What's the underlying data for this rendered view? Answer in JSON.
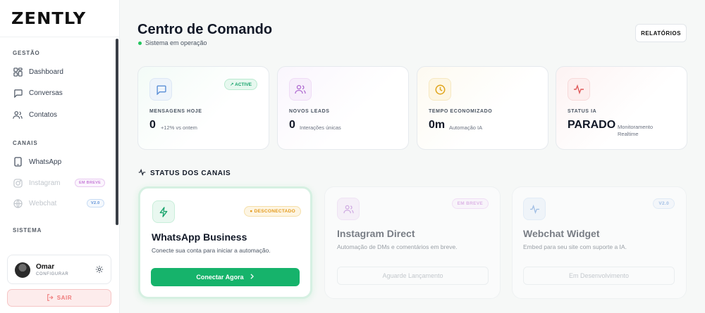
{
  "brand": {
    "logo": "ZENTLY"
  },
  "sidebar": {
    "sections": [
      {
        "title": "GESTÃO"
      },
      {
        "title": "CANAIS"
      },
      {
        "title": "SISTEMA"
      }
    ],
    "items": [
      {
        "label": "Dashboard",
        "icon": "dashboard-icon"
      },
      {
        "label": "Conversas",
        "icon": "chat-icon"
      },
      {
        "label": "Contatos",
        "icon": "users-icon"
      },
      {
        "label": "WhatsApp",
        "icon": "phone-icon"
      },
      {
        "label": "Instagram",
        "icon": "instagram-icon",
        "badge": "EM BREVE"
      },
      {
        "label": "Webchat",
        "icon": "globe-icon",
        "badge": "V2.0"
      }
    ],
    "user": {
      "name": "Omar",
      "subtitle": "CONFIGURAR"
    },
    "logout_label": "SAIR"
  },
  "header": {
    "title": "Centro de Comando",
    "status": "Sistema em operação",
    "reports_label": "RELATÓRIOS"
  },
  "stats": [
    {
      "label": "MENSAGENS HOJE",
      "value": "0",
      "sub": "+12% vs ontem",
      "badge": "ACTIVE",
      "icon": "message-icon"
    },
    {
      "label": "NOVOS LEADS",
      "value": "0",
      "sub": "Interações únicas",
      "icon": "users-icon"
    },
    {
      "label": "TEMPO ECONOMIZADO",
      "value": "0m",
      "sub": "Automação IA",
      "icon": "clock-icon"
    },
    {
      "label": "STATUS IA",
      "value": "PARADO",
      "sub": "Monitoramento Realtime",
      "icon": "pulse-icon"
    }
  ],
  "channels_section": {
    "title": "STATUS DOS CANAIS"
  },
  "channels": [
    {
      "title": "WhatsApp Business",
      "desc": "Conecte sua conta para iniciar a automação.",
      "badge": "DESCONECTADO",
      "button": "Conectar Agora"
    },
    {
      "title": "Instagram Direct",
      "desc": "Automação de DMs e comentários em breve.",
      "badge": "EM BREVE",
      "button": "Aguarde Lançamento"
    },
    {
      "title": "Webchat Widget",
      "desc": "Embed para seu site com suporte a IA.",
      "badge": "V2.0",
      "button": "Em Desenvolvimento"
    }
  ],
  "colors": {
    "accent": "#16b36b",
    "danger": "#ef7b7b"
  }
}
